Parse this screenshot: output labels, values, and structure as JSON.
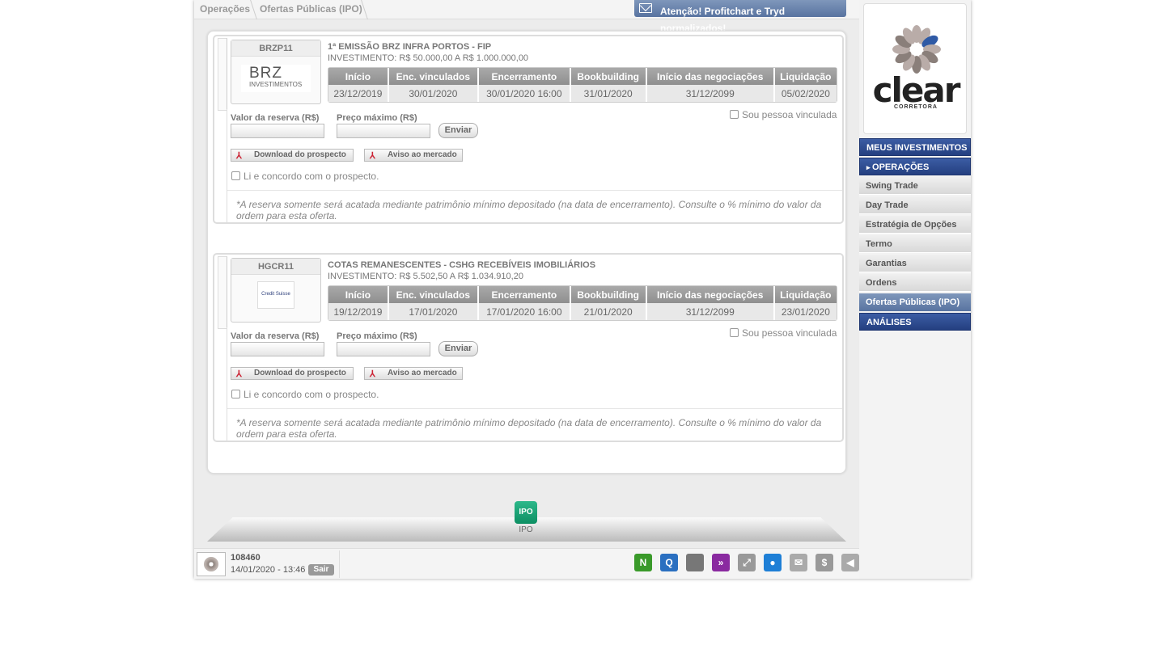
{
  "breadcrumb": {
    "root": "Operações",
    "current": "Ofertas Públicas (IPO)"
  },
  "alert": {
    "text": "Atenção! Profitchart e Tryd normalizados!"
  },
  "table_headers": [
    "Início",
    "Enc. vinculados",
    "Encerramento",
    "Bookbuilding",
    "Início das negociações",
    "Liquidação"
  ],
  "form": {
    "reserve_label": "Valor da reserva (R$)",
    "max_price_label": "Preço máximo (R$)",
    "send_label": "Enviar",
    "linked_label": "Sou pessoa vinculada",
    "download_label": "Download do prospecto",
    "notice_label": "Aviso ao mercado",
    "agree_label": "Li e concordo com o prospecto.",
    "note": "*A reserva somente será acatada mediante patrimônio mínimo depositado (na data de encerramento). Consulte o % mínimo do valor da ordem para esta oferta."
  },
  "offers": [
    {
      "code": "BRZP11",
      "logo_text": "BRZ",
      "logo_sub": "INVESTIMENTOS",
      "title": "1ª EMISSÃO BRZ INFRA PORTOS - FIP",
      "investment": "INVESTIMENTO: R$ 50.000,00 A R$ 1.000.000,00",
      "dates": [
        "23/12/2019",
        "30/01/2020",
        "30/01/2020 16:00",
        "31/01/2020",
        "31/12/2099",
        "05/02/2020"
      ]
    },
    {
      "code": "HGCR11",
      "logo_text": "Credit Suisse",
      "logo_sub": "",
      "title": "COTAS REMANESCENTES - CSHG RECEBÍVEIS IMOBILIÁRIOS",
      "investment": "INVESTIMENTO: R$ 5.502,50 A R$ 1.034.910,20",
      "dates": [
        "19/12/2019",
        "17/01/2020",
        "17/01/2020 16:00",
        "21/01/2020",
        "31/12/2099",
        "23/01/2020"
      ]
    }
  ],
  "tab": {
    "icon_text": "IPO",
    "label": "IPO"
  },
  "footer": {
    "account": "108460",
    "datetime": "14/01/2020 - 13:46",
    "logout": "Sair"
  },
  "toolbar_icons": [
    {
      "name": "news-icon",
      "glyph": "N",
      "color": "#3a9a2a"
    },
    {
      "name": "quote-icon",
      "glyph": "Q",
      "color": "#2a6fc0"
    },
    {
      "name": "candlestick-chart-icon",
      "glyph": "",
      "color": "#777777"
    },
    {
      "name": "arrow-right-icon",
      "glyph": "»",
      "color": "#8a2aa0"
    },
    {
      "name": "fullscreen-icon",
      "glyph": "⤢",
      "color": "#999999"
    },
    {
      "name": "chat-icon",
      "glyph": "●",
      "color": "#1e7fd6"
    },
    {
      "name": "mail-icon",
      "glyph": "✉",
      "color": "#aaaaaa"
    },
    {
      "name": "dollar-icon",
      "glyph": "$",
      "color": "#999999"
    },
    {
      "name": "sound-icon",
      "glyph": "◀",
      "color": "#aaaaaa"
    }
  ],
  "brand": {
    "name": "clear",
    "subtitle": "CORRETORA"
  },
  "sidebar": {
    "items": [
      {
        "label": "MEUS INVESTIMENTOS",
        "style": "blue"
      },
      {
        "label": "OPERAÇÕES",
        "style": "blue"
      },
      {
        "label": "Swing Trade",
        "style": "gray"
      },
      {
        "label": "Day Trade",
        "style": "gray"
      },
      {
        "label": "Estratégia de Opções",
        "style": "gray"
      },
      {
        "label": "Termo",
        "style": "gray"
      },
      {
        "label": "Garantias",
        "style": "gray"
      },
      {
        "label": "Ordens",
        "style": "gray"
      },
      {
        "label": "Ofertas Públicas (IPO)",
        "style": "sel"
      },
      {
        "label": "ANÁLISES",
        "style": "blue"
      }
    ]
  }
}
